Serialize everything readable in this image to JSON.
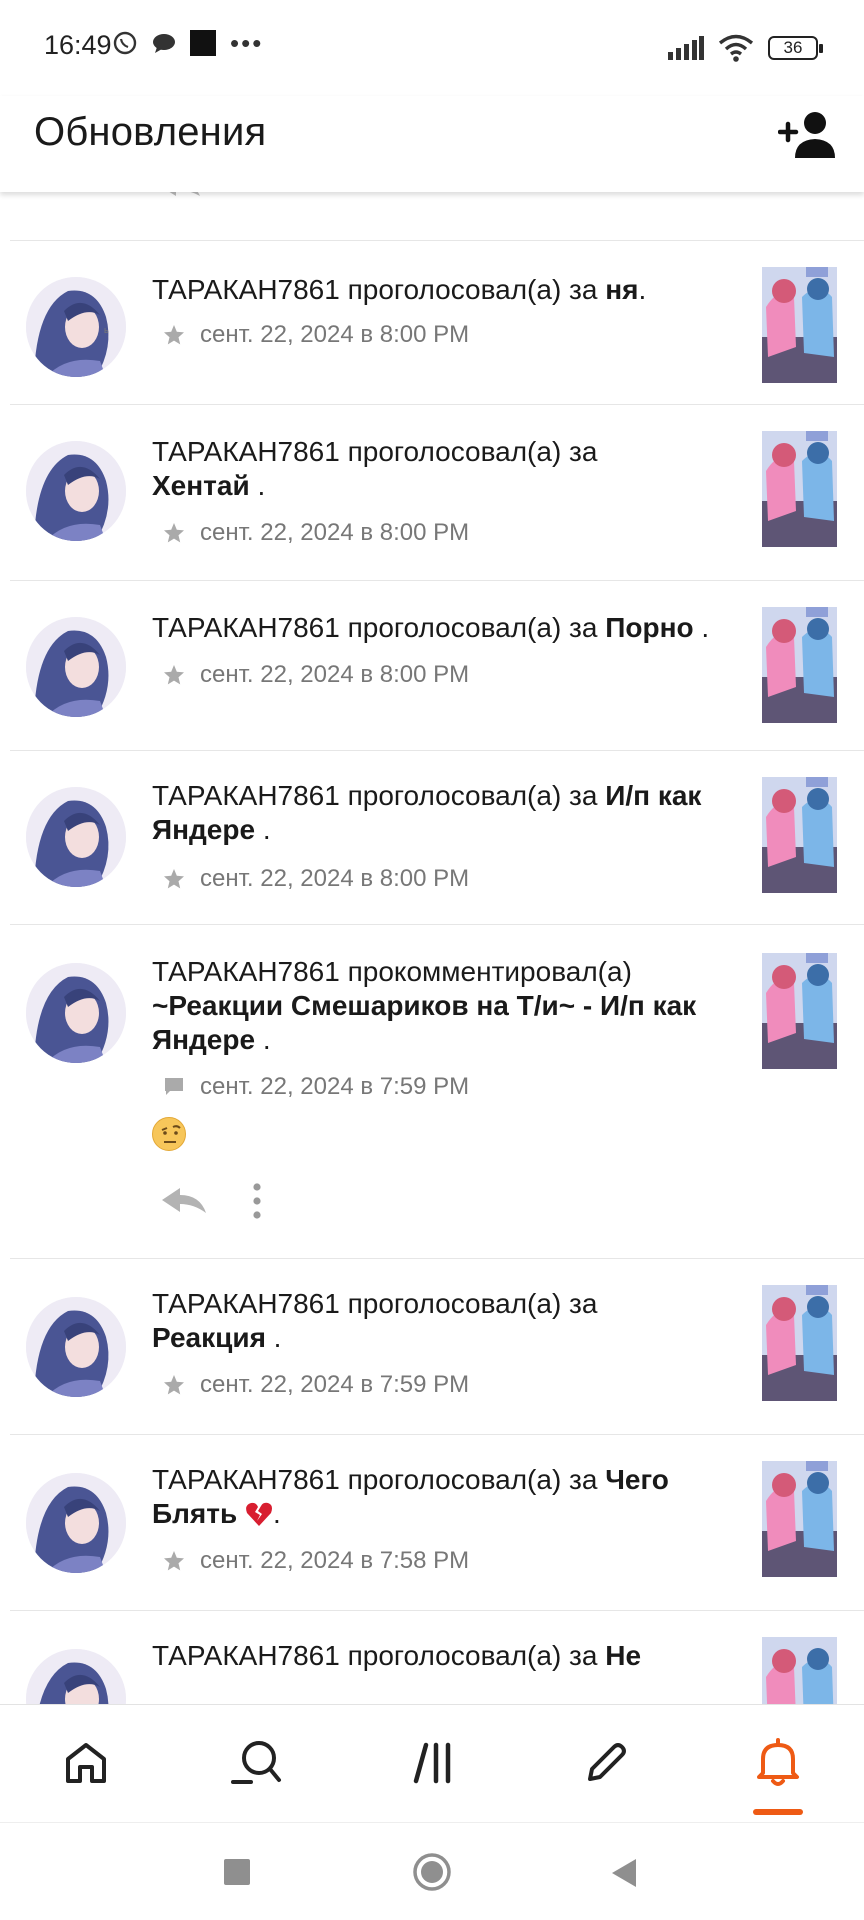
{
  "status_bar": {
    "time": "16:49",
    "battery": "36"
  },
  "app_bar": {
    "title": "Обновления",
    "add_friend_icon": "person-add-icon"
  },
  "feed": {
    "items": [
      {
        "user": "ТАРАКАН7861",
        "verb": "проголосовал(а) за",
        "target": "ня",
        "suffix": ".",
        "date": "сент. 22, 2024 в 8:00 PM",
        "meta_icon": "star-icon"
      },
      {
        "user": "ТАРАКАН7861",
        "verb": "проголосовал(а) за",
        "target": "Хентай",
        "suffix": " .",
        "date": "сент. 22, 2024 в 8:00 PM",
        "meta_icon": "star-icon"
      },
      {
        "user": "ТАРАКАН7861",
        "verb": "проголосовал(а) за",
        "target": "Порно",
        "suffix": " .",
        "date": "сент. 22, 2024 в 8:00 PM",
        "meta_icon": "star-icon"
      },
      {
        "user": "ТАРАКАН7861",
        "verb": "проголосовал(а) за",
        "target": "И/п как Яндере",
        "suffix": " .",
        "date": "сент. 22, 2024 в 8:00 PM",
        "meta_icon": "star-icon"
      },
      {
        "user": "ТАРАКАН7861",
        "verb": "прокомментировал(а)",
        "target": "~Реакции Смешариков на Т/и~ - И/п как Яндере",
        "suffix": " .",
        "date": "сент. 22, 2024 в 7:59 PM",
        "meta_icon": "comment-icon",
        "comment_emoji": "raised-eyebrow-emoji"
      },
      {
        "user": "ТАРАКАН7861",
        "verb": "проголосовал(а) за",
        "target": "Реакция",
        "suffix": " .",
        "date": "сент. 22, 2024 в 7:59 PM",
        "meta_icon": "star-icon"
      },
      {
        "user": "ТАРАКАН7861",
        "verb": "проголосовал(а) за",
        "target": "Чего Блять",
        "suffix": ".",
        "target_emoji": "broken-heart-emoji",
        "date": "сент. 22, 2024 в 7:58 PM",
        "meta_icon": "star-icon"
      },
      {
        "user": "ТАРАКАН7861",
        "verb": "проголосовал(а) за",
        "target": "Не"
      }
    ]
  },
  "bottom_nav": {
    "items": [
      "home-icon",
      "search-icon",
      "library-icon",
      "write-icon",
      "notifications-icon"
    ],
    "active": "notifications-icon",
    "accent": "#EE5A14"
  },
  "system_nav": [
    "recents-icon",
    "home-circle-icon",
    "back-icon"
  ]
}
